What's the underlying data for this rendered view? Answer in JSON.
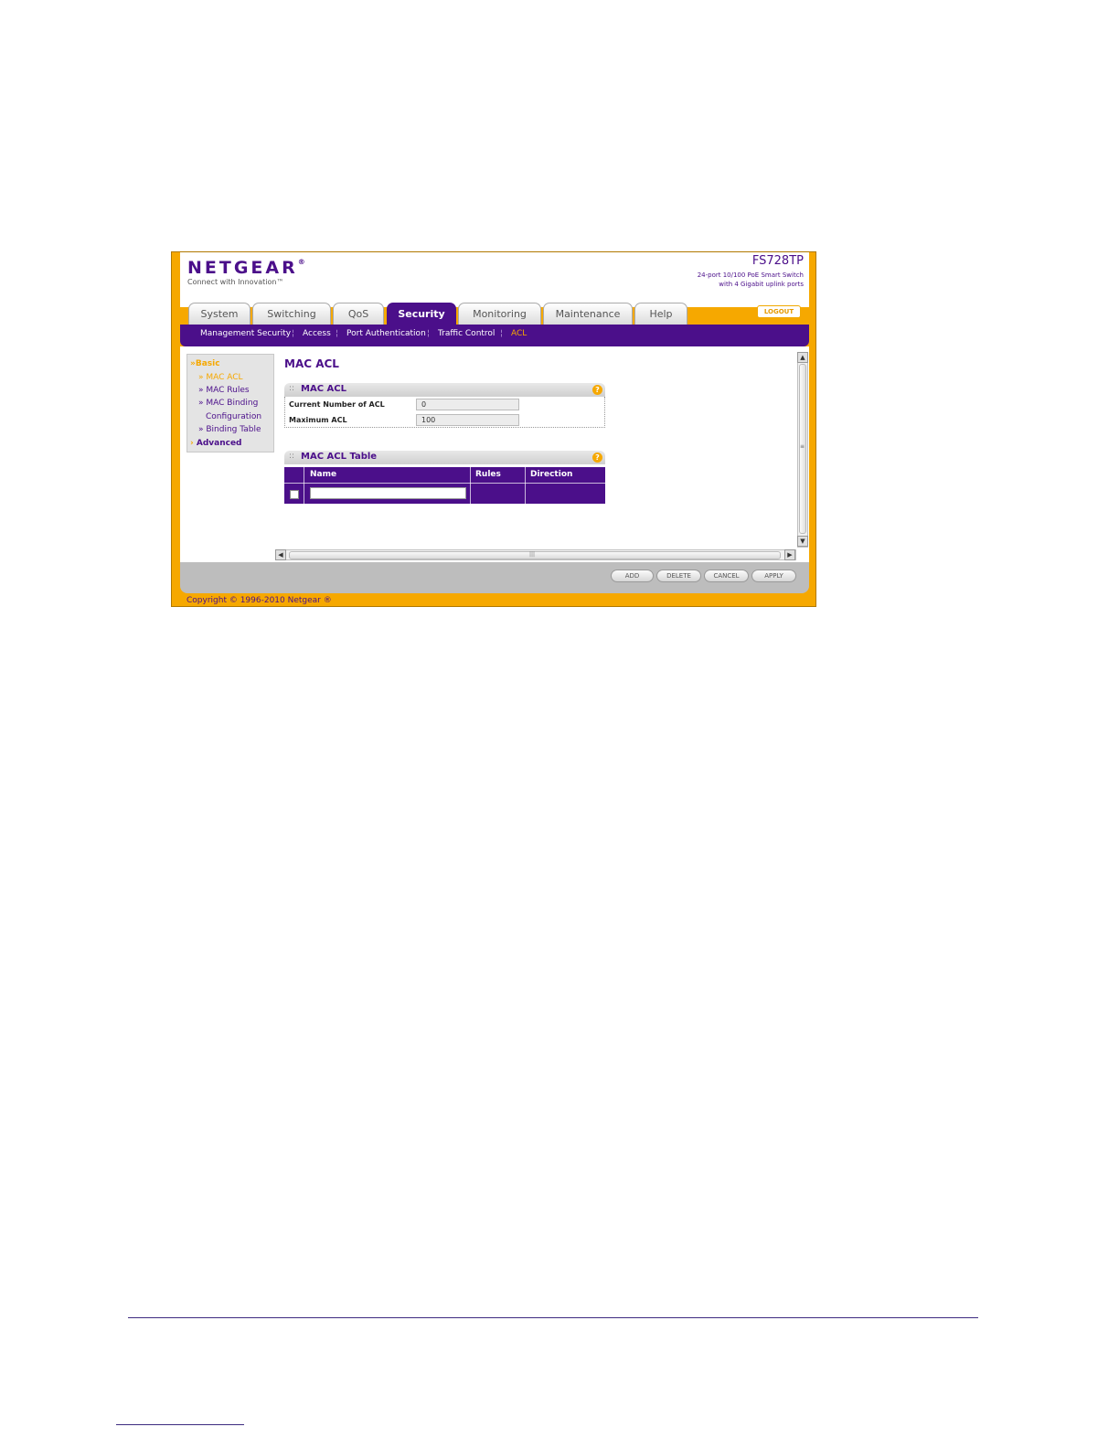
{
  "header": {
    "logo": "NETGEAR",
    "logo_mark": "®",
    "tagline": "Connect with Innovation™",
    "model": "FS728TP",
    "desc_line1": "24-port 10/100 PoE Smart Switch",
    "desc_line2": "with 4 Gigabit uplink ports",
    "logout": "LOGOUT"
  },
  "tabs": [
    "System",
    "Switching",
    "QoS",
    "Security",
    "Monitoring",
    "Maintenance",
    "Help"
  ],
  "subnav": [
    "Management Security",
    "Access",
    "Port Authentication",
    "Traffic Control",
    "ACL"
  ],
  "sidebar": {
    "basic": "Basic",
    "items": [
      "» MAC ACL",
      "» MAC Rules",
      "» MAC Binding",
      "Configuration",
      "» Binding Table"
    ],
    "advanced": "Advanced"
  },
  "page": {
    "title": "MAC ACL"
  },
  "acl_panel": {
    "title": "MAC ACL",
    "help": "?",
    "fields": [
      {
        "label": "Current Number of ACL",
        "value": "0"
      },
      {
        "label": "Maximum ACL",
        "value": "100"
      }
    ]
  },
  "acl_table": {
    "title": "MAC ACL Table",
    "help": "?",
    "columns": [
      "Name",
      "Rules",
      "Direction"
    ]
  },
  "scroll": {
    "up": "▲",
    "down": "▼",
    "left": "◀",
    "right": "▶",
    "grip_v": "≡",
    "grip_h": "|||"
  },
  "buttons": [
    "ADD",
    "DELETE",
    "CANCEL",
    "APPLY"
  ],
  "footer": {
    "copyright": "Copyright © 1996-2010 Netgear ®"
  },
  "colors": {
    "brand_purple": "#4b0f8a",
    "accent_orange": "#f6a800"
  }
}
